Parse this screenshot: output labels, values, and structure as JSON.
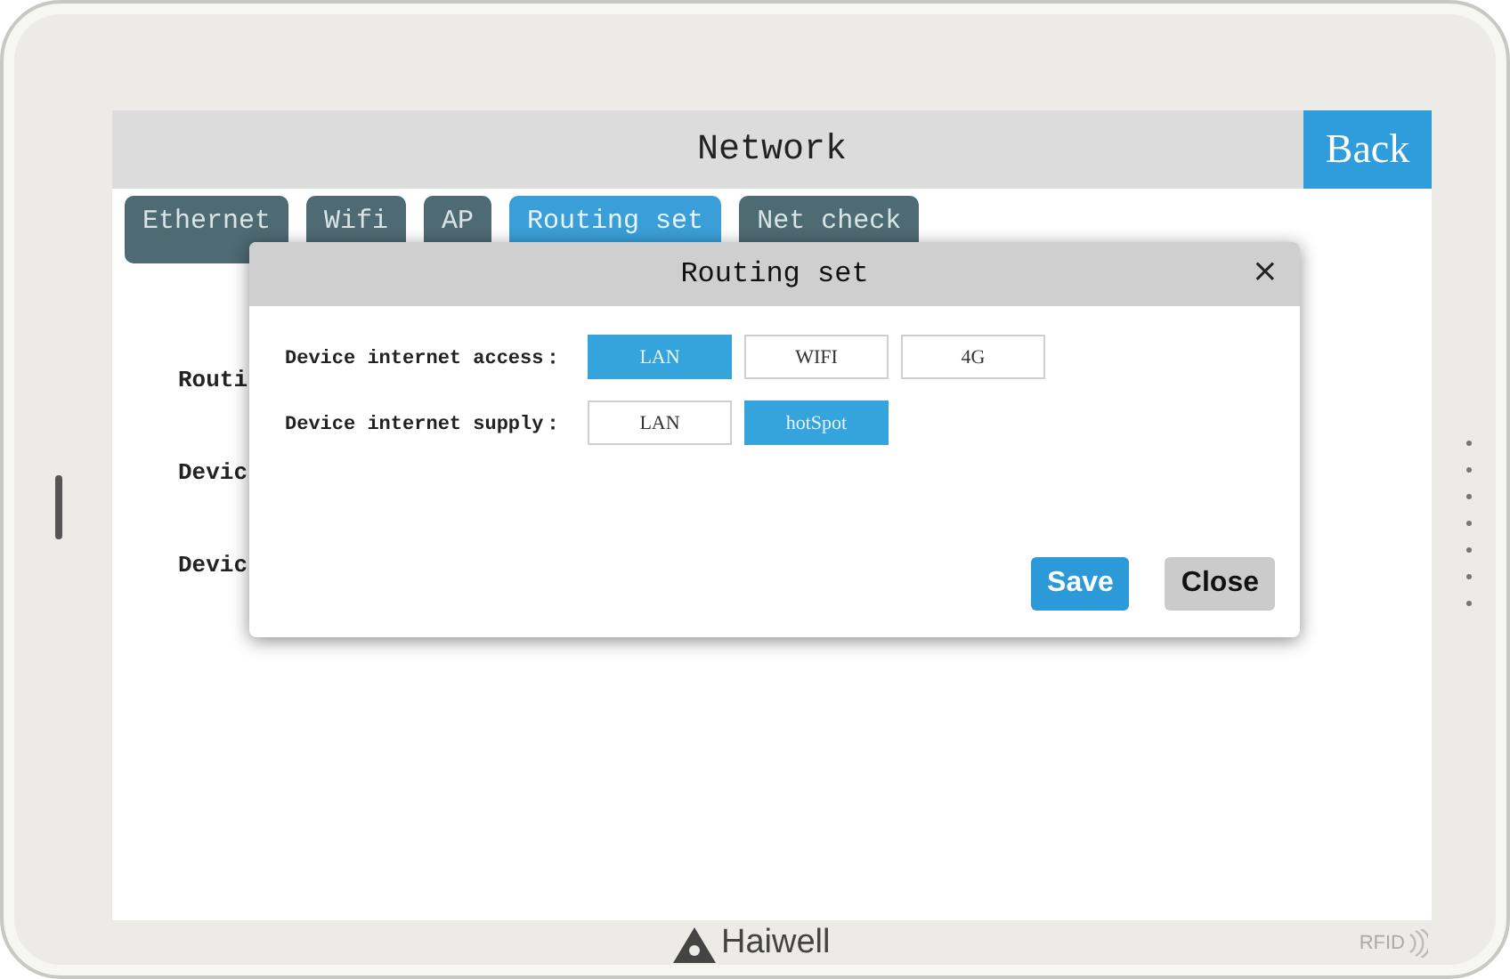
{
  "window": {
    "title": "Network"
  },
  "back_button": "Back",
  "tabs": [
    {
      "label": "Ethernet",
      "selected": false
    },
    {
      "label": "Wifi",
      "selected": false
    },
    {
      "label": "AP",
      "selected": false
    },
    {
      "label": "Routing set",
      "selected": true
    },
    {
      "label": "Net check",
      "selected": false
    }
  ],
  "settings": [
    {
      "label": "Routi"
    },
    {
      "label": "Devic"
    },
    {
      "label": "Devic"
    }
  ],
  "dialog": {
    "title": "Routing set",
    "close": "×",
    "rows": [
      {
        "label": "Device internet access：",
        "options": [
          {
            "label": "LAN",
            "selected": true
          },
          {
            "label": "WIFI",
            "selected": false
          },
          {
            "label": "4G",
            "selected": false
          }
        ]
      },
      {
        "label": "Device internet supply：",
        "options": [
          {
            "label": "LAN",
            "selected": false
          },
          {
            "label": "hotSpot",
            "selected": true
          }
        ]
      }
    ],
    "buttons": [
      {
        "label": "Save",
        "kind": "primary"
      },
      {
        "label": "Close",
        "kind": "secondary"
      }
    ]
  },
  "bezel": {
    "brand": "Haiwell",
    "badge": "RFID"
  }
}
